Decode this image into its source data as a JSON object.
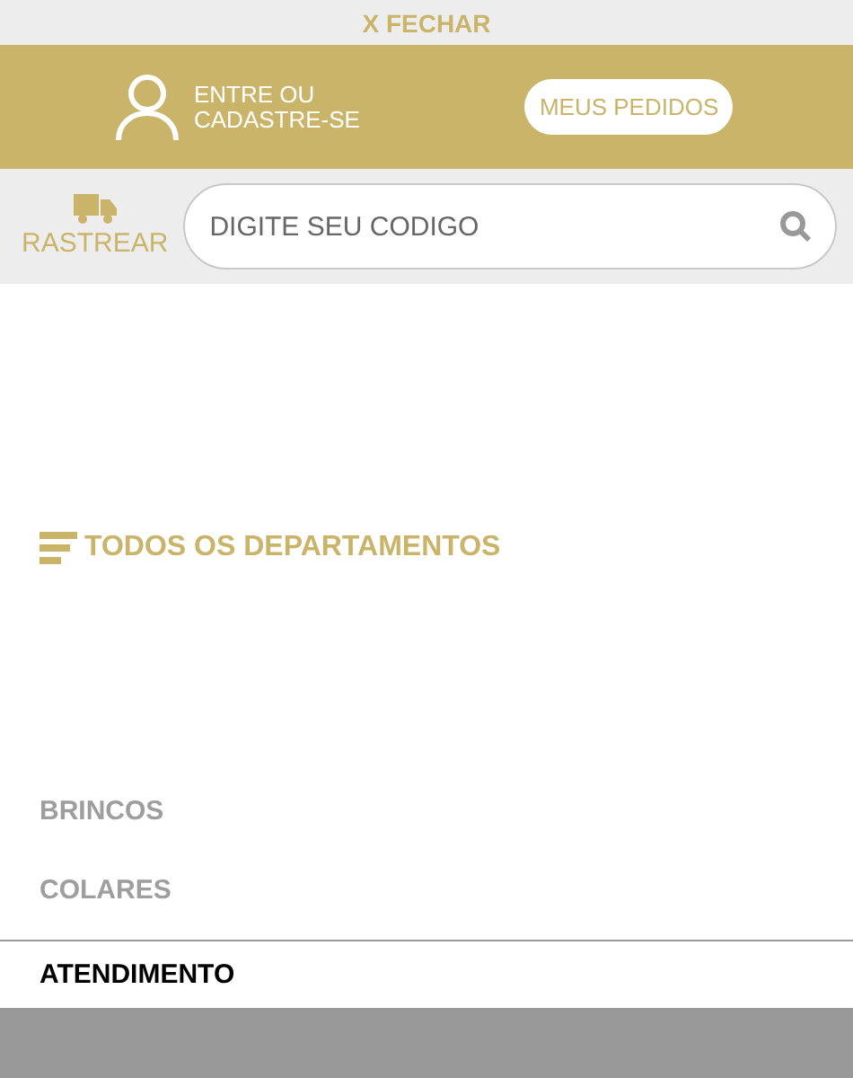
{
  "close_link": "X FECHAR",
  "account": {
    "login": "ENTRE OU\nCADASTRE-SE",
    "orders_button": "MEUS PEDIDOS"
  },
  "tracking": {
    "label": "RASTREAR",
    "search": {
      "placeholder": "DIGITE SEU CODIGO"
    }
  },
  "departments": {
    "title": "TODOS OS DEPARTAMENTOS",
    "items": [
      {
        "label": "BRINCOS"
      },
      {
        "label": "COLARES"
      }
    ]
  },
  "support": "ATENDIMENTO"
}
